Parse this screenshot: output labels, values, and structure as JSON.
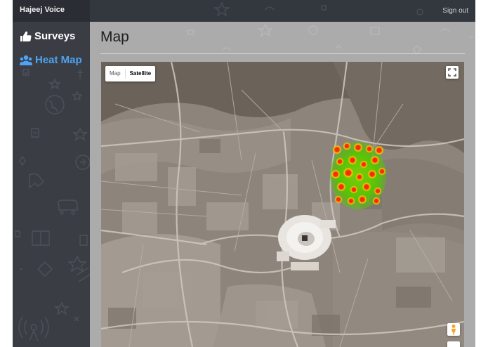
{
  "header": {
    "brand": "Hajeej Voice",
    "sign_out": "Sign out"
  },
  "sidebar": {
    "items": [
      {
        "label": "Surveys",
        "icon": "thumbs-up-icon",
        "active": false
      },
      {
        "label": "Heat Map",
        "icon": "people-group-icon",
        "active": true
      }
    ]
  },
  "main": {
    "title": "Map"
  },
  "map": {
    "type_controls": [
      {
        "label": "Map",
        "selected": false
      },
      {
        "label": "Satellite",
        "selected": true
      }
    ],
    "fullscreen_icon": "fullscreen-icon",
    "street_view_icon": "pegman-icon"
  },
  "colors": {
    "topbar": "#33373e",
    "sidebar": "#3a3d44",
    "active_nav": "#4ea3f2",
    "content_bg": "#ababab"
  }
}
